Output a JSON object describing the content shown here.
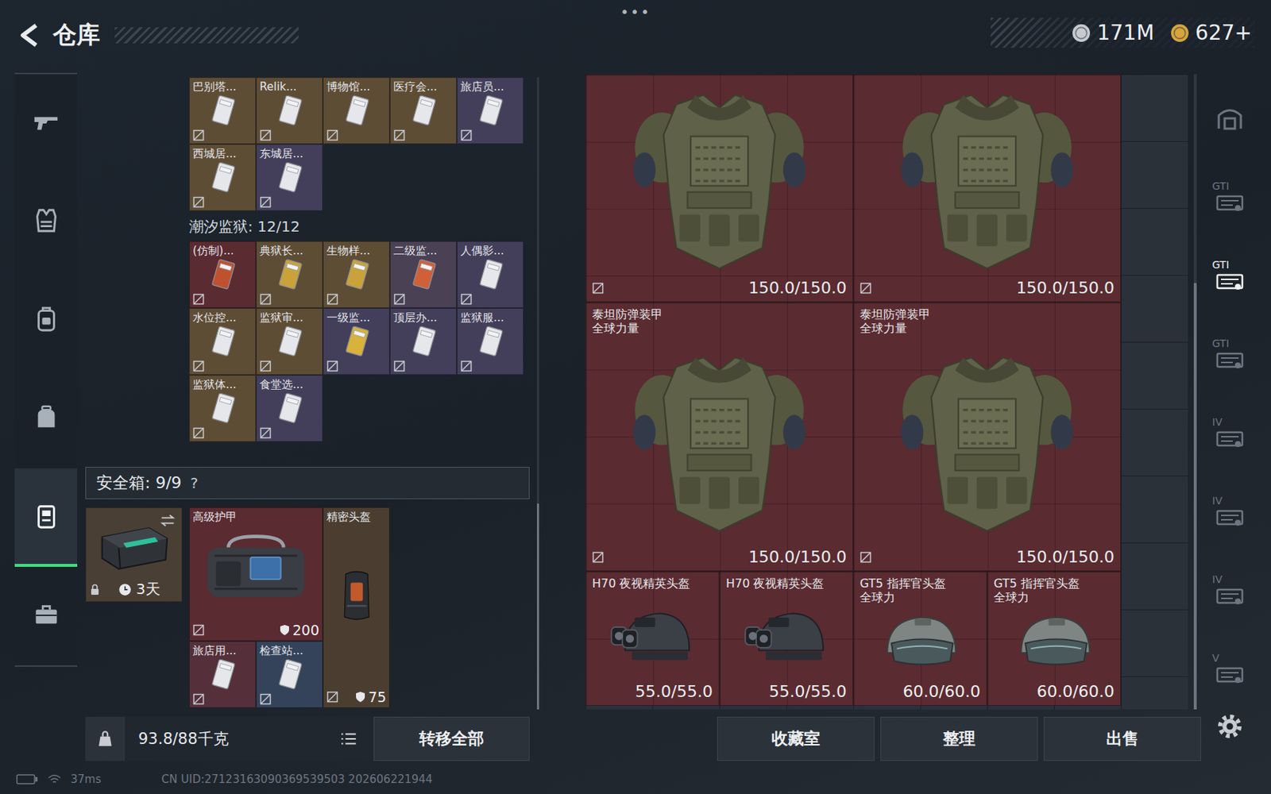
{
  "header": {
    "title": "仓库",
    "menu": "•••",
    "currencies": [
      {
        "value": "171M",
        "color": "#c7cbd0"
      },
      {
        "value": "627+",
        "color": "#d6a53c"
      }
    ]
  },
  "left_nav": [
    {
      "kind": "gun",
      "selected": false
    },
    {
      "kind": "vest",
      "selected": false
    },
    {
      "kind": "rig",
      "selected": false
    },
    {
      "kind": "backpack",
      "selected": false
    },
    {
      "kind": "safe",
      "selected": true
    },
    {
      "kind": "case",
      "selected": false
    }
  ],
  "key_groups": [
    {
      "title": "",
      "items": [
        {
          "name": "巴别塔...",
          "color": "#5e4d35",
          "card_color": "#e6e7ea",
          "marked": true
        },
        {
          "name": "Relik...",
          "color": "#5e4d35",
          "card_color": "#e6e7ea",
          "marked": true
        },
        {
          "name": "博物馆...",
          "color": "#5e4d35",
          "card_color": "#e6e7ea",
          "marked": true
        },
        {
          "name": "医疗会...",
          "color": "#5e4d35",
          "card_color": "#e6e7ea",
          "marked": true
        },
        {
          "name": "旅店员...",
          "color": "#433f5a",
          "card_color": "#e6e7ea",
          "marked": true
        },
        {
          "name": "西城居...",
          "color": "#5e4d35",
          "card_color": "#e6e7ea",
          "marked": true
        },
        {
          "name": "东城居...",
          "color": "#433f5a",
          "card_color": "#e6e7ea",
          "marked": true
        }
      ]
    },
    {
      "title": "潮汐监狱: 12/12",
      "items": [
        {
          "name": "(仿制)...",
          "color": "#5a2b31",
          "card_color": "#c0512f",
          "marked": true
        },
        {
          "name": "典狱长...",
          "color": "#5e4d35",
          "card_color": "#c9a23a",
          "marked": true
        },
        {
          "name": "生物样...",
          "color": "#5e4d35",
          "card_color": "#c9a23a",
          "marked": true
        },
        {
          "name": "二级监...",
          "color": "#4a4155",
          "card_color": "#d0603a",
          "marked": true
        },
        {
          "name": "人偶影...",
          "color": "#433f5a",
          "card_color": "#e6e7ea",
          "marked": true
        },
        {
          "name": "水位控...",
          "color": "#5e4d35",
          "card_color": "#e6e7ea",
          "marked": true
        },
        {
          "name": "监狱审...",
          "color": "#5e4d35",
          "card_color": "#e6e7ea",
          "marked": true
        },
        {
          "name": "一级监...",
          "color": "#433f5a",
          "card_color": "#d8b23a",
          "marked": true
        },
        {
          "name": "顶层办...",
          "color": "#433f5a",
          "card_color": "#e6e7ea",
          "marked": true
        },
        {
          "name": "监狱服...",
          "color": "#433f5a",
          "card_color": "#e6e7ea",
          "marked": true
        },
        {
          "name": "监狱体...",
          "color": "#5e4d35",
          "card_color": "#e6e7ea",
          "marked": true
        },
        {
          "name": "食堂选...",
          "color": "#433f5a",
          "card_color": "#e6e7ea",
          "marked": true
        }
      ]
    }
  ],
  "safe_box": {
    "title": "安全箱: 9/9",
    "help": "?",
    "container": {
      "timer": "3天",
      "locked": true
    },
    "items": [
      {
        "kind": "bag",
        "name": "高级护甲",
        "reading": "200",
        "color": "#5a2b31",
        "marked": true
      },
      {
        "kind": "helmet",
        "name": "精密头盔",
        "reading": "75",
        "color": "#4b3e30",
        "marked": true
      },
      {
        "kind": "card",
        "name": "旅店用...",
        "color": "#55303a",
        "card_color": "#e6e7ea",
        "marked": true
      },
      {
        "kind": "card",
        "name": "检查站...",
        "color": "#34435a",
        "card_color": "#e6e7ea",
        "marked": true
      }
    ]
  },
  "inventory": {
    "weight": "93.8/88千克",
    "transfer": "转移全部"
  },
  "storage": {
    "items": [
      {
        "kind": "armor",
        "name_lines": [],
        "reading": "150.0/150.0",
        "color": "#5a2b31",
        "marked": true
      },
      {
        "kind": "armor",
        "name_lines": [],
        "reading": "150.0/150.0",
        "color": "#5a2b31",
        "marked": true
      },
      {
        "kind": "armor",
        "name_lines": [
          "泰坦防弹装甲",
          "全球力量"
        ],
        "reading": "150.0/150.0",
        "color": "#5a2b31",
        "marked": true
      },
      {
        "kind": "armor",
        "name_lines": [
          "泰坦防弹装甲",
          "全球力量"
        ],
        "reading": "150.0/150.0",
        "color": "#5a2b31",
        "marked": true
      },
      {
        "kind": "nv-helmet",
        "name_lines": [
          "H70 夜视精英头盔"
        ],
        "reading": "55.0/55.0",
        "color": "#5a2b31",
        "marked": false
      },
      {
        "kind": "nv-helmet",
        "name_lines": [
          "H70 夜视精英头盔"
        ],
        "reading": "55.0/55.0",
        "color": "#5a2b31",
        "marked": false
      },
      {
        "kind": "cmd-helmet",
        "name_lines": [
          "GT5 指挥官头盔",
          "全球力"
        ],
        "reading": "60.0/60.0",
        "color": "#5a2b31",
        "marked": false
      },
      {
        "kind": "cmd-helmet",
        "name_lines": [
          "GT5 指挥官头盔",
          "全球力"
        ],
        "reading": "60.0/60.0",
        "color": "#5a2b31",
        "marked": false
      }
    ],
    "buttons": [
      "收藏室",
      "整理",
      "出售"
    ]
  },
  "right_nav": [
    {
      "kind": "shelter",
      "label": "",
      "selected": false
    },
    {
      "kind": "case",
      "label": "GTI",
      "selected": false
    },
    {
      "kind": "case",
      "label": "GTI",
      "selected": true
    },
    {
      "kind": "case",
      "label": "GTI",
      "selected": false
    },
    {
      "kind": "case",
      "label": "IV",
      "selected": false
    },
    {
      "kind": "case",
      "label": "IV",
      "selected": false
    },
    {
      "kind": "case",
      "label": "IV",
      "selected": false
    },
    {
      "kind": "case",
      "label": "V",
      "selected": false
    }
  ],
  "status_bar": {
    "ping": "37ms",
    "uid": "CN UID:27123163090369539503 202606221944"
  }
}
